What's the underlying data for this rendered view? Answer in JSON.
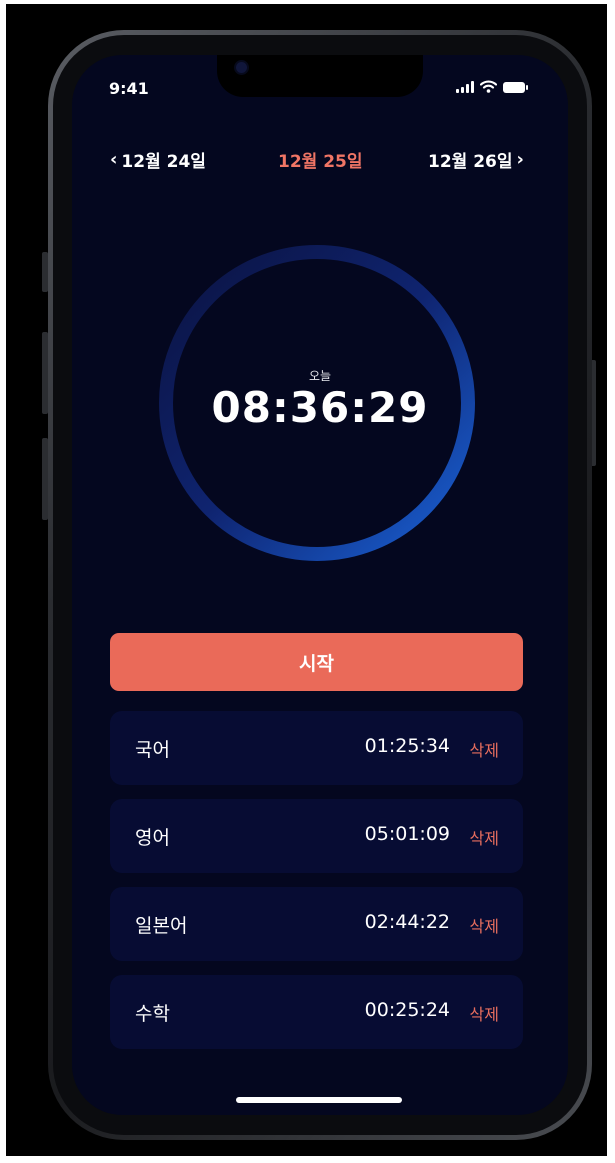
{
  "status_bar": {
    "time": "9:41"
  },
  "date_nav": {
    "prev": "12월 24일",
    "current": "12월 25일",
    "next": "12월 26일"
  },
  "timer": {
    "label": "오늘",
    "value": "08:36:29"
  },
  "start_button": {
    "label": "시작"
  },
  "subjects": [
    {
      "name": "국어",
      "time": "01:25:34",
      "delete_label": "삭제"
    },
    {
      "name": "영어",
      "time": "05:01:09",
      "delete_label": "삭제"
    },
    {
      "name": "일본어",
      "time": "02:44:22",
      "delete_label": "삭제"
    },
    {
      "name": "수학",
      "time": "00:25:24",
      "delete_label": "삭제"
    }
  ],
  "colors": {
    "background": "#04071f",
    "accent": "#ea6a59",
    "ring_gradient_start": "#0b1240",
    "ring_gradient_end": "#1a63d8",
    "row_background": "#070c33"
  }
}
